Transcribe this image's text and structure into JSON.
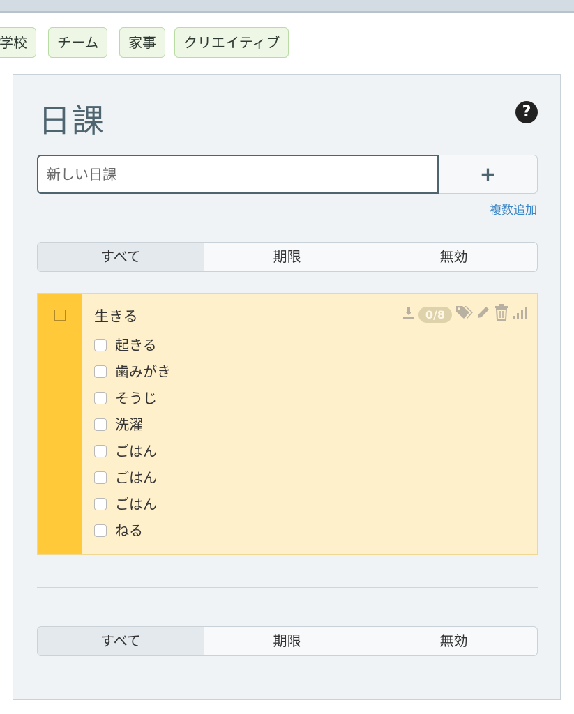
{
  "tags": [
    "学校",
    "チーム",
    "家事",
    "クリエイティブ"
  ],
  "panel": {
    "title": "日課",
    "help_label": "?",
    "add_input": {
      "placeholder": "新しい日課",
      "value": ""
    },
    "add_button": "+",
    "bulk_add": "複数追加",
    "filters_top": [
      "すべて",
      "期限",
      "無効"
    ],
    "filters_bottom": [
      "すべて",
      "期限",
      "無効"
    ],
    "active_filter": "すべて"
  },
  "task": {
    "name": "生きる",
    "badge": "0/8",
    "color": "#ffc93a",
    "icons": [
      "download-icon",
      "tag-icon",
      "edit-icon",
      "trash-icon",
      "difficulty-icon"
    ],
    "checklist": [
      {
        "label": "起きる",
        "checked": false
      },
      {
        "label": "歯みがき",
        "checked": false
      },
      {
        "label": "そうじ",
        "checked": false
      },
      {
        "label": "洗濯",
        "checked": false
      },
      {
        "label": "ごはん",
        "checked": false
      },
      {
        "label": "ごはん",
        "checked": false
      },
      {
        "label": "ごはん",
        "checked": false
      },
      {
        "label": "ねる",
        "checked": false
      }
    ]
  }
}
